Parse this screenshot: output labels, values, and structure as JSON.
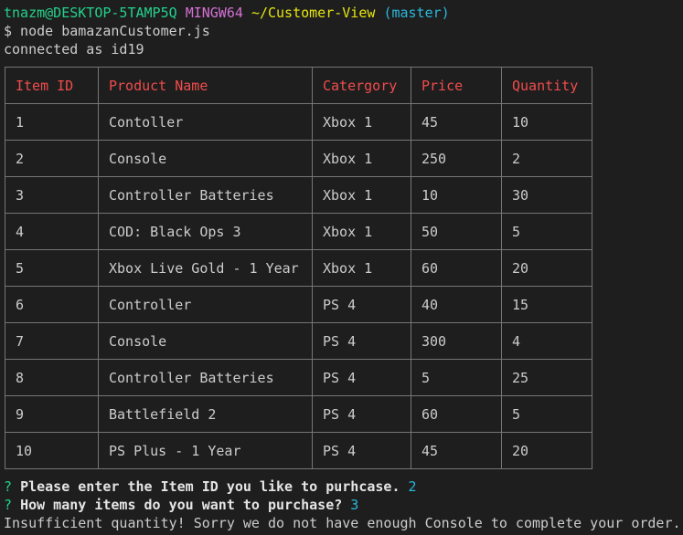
{
  "prompt_header": {
    "user_host": "tnazm@DESKTOP-5TAMP5Q",
    "shell": "MINGW64",
    "path": "~/Customer-View",
    "branch": "(master)"
  },
  "command": "$ node bamazanCustomer.js",
  "connected": "connected as id19",
  "table": {
    "headers": [
      "Item ID",
      "Product Name",
      "Catergory",
      "Price",
      "Quantity"
    ],
    "rows": [
      [
        "1",
        "Contoller",
        "Xbox 1",
        "45",
        "10"
      ],
      [
        "2",
        "Console",
        "Xbox 1",
        "250",
        "2"
      ],
      [
        "3",
        "Controller Batteries",
        "Xbox 1",
        "10",
        "30"
      ],
      [
        "4",
        "COD: Black Ops 3",
        "Xbox 1",
        "50",
        "5"
      ],
      [
        "5",
        "Xbox Live Gold - 1 Year",
        "Xbox 1",
        "60",
        "20"
      ],
      [
        "6",
        "Controller",
        "PS 4",
        "40",
        "15"
      ],
      [
        "7",
        "Console",
        "PS 4",
        "300",
        "4"
      ],
      [
        "8",
        "Controller Batteries",
        "PS 4",
        "5",
        "25"
      ],
      [
        "9",
        "Battlefield 2",
        "PS 4",
        "60",
        "5"
      ],
      [
        "10",
        "PS Plus - 1 Year",
        "PS 4",
        "45",
        "20"
      ]
    ]
  },
  "questions": [
    {
      "mark": "?",
      "text": "Please enter the Item ID you like to purhcase.",
      "answer": "2"
    },
    {
      "mark": "?",
      "text": "How many items do you want to purchase?",
      "answer": "3"
    }
  ],
  "result": "Insufficient quantity! Sorry we do not have enough Console to complete your order.",
  "colors": {
    "background": "#1e1e1e",
    "header_text": "#f14c4c",
    "border": "#767676"
  }
}
